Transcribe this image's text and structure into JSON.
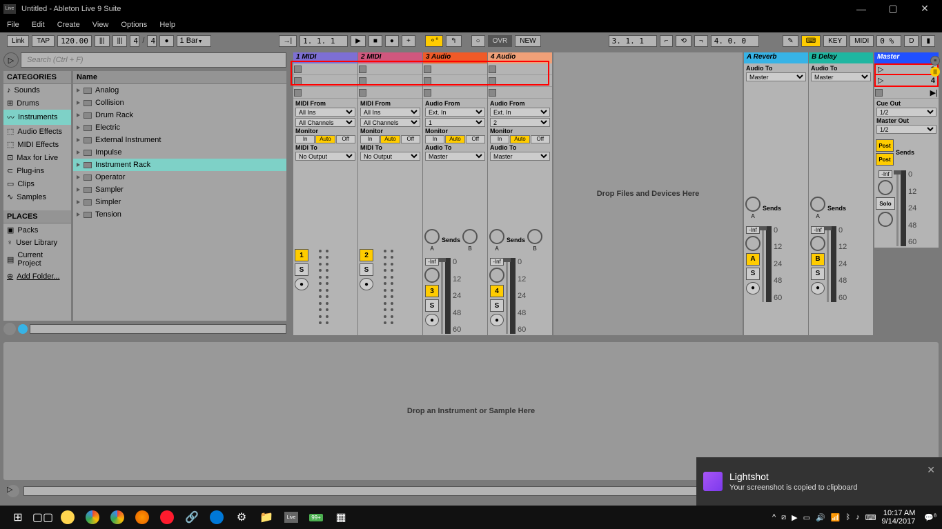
{
  "window": {
    "title": "Untitled - Ableton Live 9 Suite",
    "icon_label": "Live"
  },
  "menu": [
    "File",
    "Edit",
    "Create",
    "View",
    "Options",
    "Help"
  ],
  "toolbar": {
    "link": "Link",
    "tap": "TAP",
    "tempo": "120.00",
    "sig_num": "4",
    "sig_den": "4",
    "quantize": "1 Bar",
    "position": "1.  1.  1",
    "overdub": "OVR",
    "new_btn": "NEW",
    "loop_pos": "3.  1.  1",
    "loop_len": "4.  0.  0",
    "key": "KEY",
    "midi": "MIDI",
    "cpu": "0 %",
    "d": "D"
  },
  "browser": {
    "search_placeholder": "Search (Ctrl + F)",
    "categories_header": "CATEGORIES",
    "categories": [
      "Sounds",
      "Drums",
      "Instruments",
      "Audio Effects",
      "MIDI Effects",
      "Max for Live",
      "Plug-ins",
      "Clips",
      "Samples"
    ],
    "places_header": "PLACES",
    "places": [
      "Packs",
      "User Library",
      "Current Project",
      "Add Folder..."
    ],
    "name_header": "Name",
    "instruments": [
      "Analog",
      "Collision",
      "Drum Rack",
      "Electric",
      "External Instrument",
      "Impulse",
      "Instrument Rack",
      "Operator",
      "Sampler",
      "Simpler",
      "Tension"
    ],
    "selected_category": "Instruments",
    "selected_instrument": "Instrument Rack"
  },
  "tracks": [
    {
      "name": "1 MIDI",
      "color": "#7d6fd4",
      "from_label": "MIDI From",
      "from": "All Ins",
      "ch": "All Channels",
      "mon_label": "Monitor",
      "to_label": "MIDI To",
      "to": "No Output",
      "num": "1"
    },
    {
      "name": "2 MIDI",
      "color": "#d0577e",
      "from_label": "MIDI From",
      "from": "All Ins",
      "ch": "All Channels",
      "mon_label": "Monitor",
      "to_label": "MIDI To",
      "to": "No Output",
      "num": "2"
    },
    {
      "name": "3 Audio",
      "color": "#f05a28",
      "from_label": "Audio From",
      "from": "Ext. In",
      "ch": "1",
      "mon_label": "Monitor",
      "to_label": "Audio To",
      "to": "Master",
      "num": "3"
    },
    {
      "name": "4 Audio",
      "color": "#f0a078",
      "from_label": "Audio From",
      "from": "Ext. In",
      "ch": "2",
      "mon_label": "Monitor",
      "to_label": "Audio To",
      "to": "Master",
      "num": "4"
    }
  ],
  "returns": [
    {
      "name": "A Reverb",
      "color": "#37b3e6",
      "to_label": "Audio To",
      "to": "Master",
      "letter": "A"
    },
    {
      "name": "B Delay",
      "color": "#1fb6a1",
      "to_label": "Audio To",
      "to": "Master",
      "letter": "B"
    }
  ],
  "master": {
    "name": "Master",
    "color": "#2050ff",
    "scenes": [
      "3",
      "4"
    ],
    "cue_label": "Cue Out",
    "cue": "1/2",
    "master_label": "Master Out",
    "master_out": "1/2",
    "solo": "Solo"
  },
  "drop_files": "Drop Files and Devices Here",
  "drop_instrument": "Drop an Instrument or Sample Here",
  "monitor_opts": {
    "in": "In",
    "auto": "Auto",
    "off": "Off"
  },
  "sends_label": "Sends",
  "post_label": "Post",
  "db_marks": [
    "0",
    "12",
    "24",
    "48",
    "60"
  ],
  "vol_db": "-Inf",
  "pan": "0",
  "solo_btn": "S",
  "rec_btn": "●",
  "notification": {
    "title": "Lightshot",
    "body": "Your screenshot is copied to clipboard"
  },
  "systray": {
    "time": "10:17 AM",
    "date": "9/14/2017",
    "count": "99+",
    "notif": "8"
  }
}
